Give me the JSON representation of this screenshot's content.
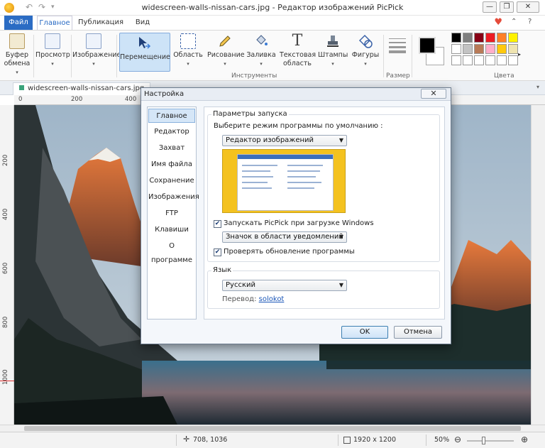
{
  "window": {
    "title": "widescreen-walls-nissan-cars.jpg - Редактор изображений PicPick",
    "min_glyph": "—",
    "restore_glyph": "❐",
    "close_glyph": "✕",
    "undo_glyph": "↶",
    "redo_glyph": "↷",
    "qa_menu_glyph": "▾"
  },
  "tabs": {
    "file": "Файл",
    "home": "Главное",
    "publish": "Публикация",
    "view": "Вид",
    "heart_glyph": "♥",
    "minimize_ribbon_glyph": "⌃",
    "help_glyph": "?"
  },
  "ribbon": {
    "clipboard": "Буфер\nобмена",
    "preview": "Просмотр",
    "image": "Изображение",
    "move": "Перемещение",
    "area": "Область",
    "draw": "Рисование",
    "fill": "Заливка",
    "text": "Текстовая\nобласть",
    "stamps": "Штампы",
    "shapes": "Фигуры",
    "group_tools": "Инструменты",
    "group_size": "Размер",
    "group_colors": "Цвета",
    "text_glyph": "T",
    "dropdown_glyph": "▾",
    "palette": [
      "#000000",
      "#7f7f7f",
      "#880015",
      "#ed1c24",
      "#ff7f27",
      "#fff200",
      "#ffffff",
      "#c3c3c3",
      "#b97a57",
      "#ffaec9",
      "#ffc90e",
      "#efe4b0",
      "#ffffff",
      "#ffffff",
      "#ffffff",
      "#ffffff",
      "#ffffff",
      "#ffffff"
    ]
  },
  "document": {
    "tab_name": "widescreen-walls-nissan-cars.jpg",
    "tab_close_glyph": "▾"
  },
  "ruler": {
    "top_ticks": [
      "0",
      "200",
      "400"
    ],
    "left_ticks": [
      "200",
      "400",
      "600",
      "800",
      "1000"
    ]
  },
  "dialog": {
    "title": "Настройка",
    "close_glyph": "✕",
    "nav": [
      "Главное",
      "Редактор",
      "Захват",
      "Имя файла",
      "Сохранение",
      "Изображения",
      "FTP",
      "Клавиши",
      "О программе"
    ],
    "startup_group": "Параметры запуска",
    "startup_prompt": "Выберите режим программы по умолчанию :",
    "startup_mode": "Редактор изображений",
    "launch_on_windows": "Запускать PicPick при загрузке Windows",
    "launch_on_windows_checked": "✔",
    "tray_mode": "Значок в области уведомлений",
    "check_updates": "Проверять обновление программы",
    "check_updates_checked": "✔",
    "language_group": "Язык",
    "language": "Русский",
    "translation_label": "Перевод:",
    "translator": "solokot",
    "ok": "OK",
    "cancel": "Отмена",
    "select_arrow": "▼"
  },
  "status": {
    "cursor": "708, 1036",
    "image_size": "1920 x 1200",
    "zoom": "50%",
    "zoom_out_glyph": "⊖",
    "zoom_in_glyph": "⊕",
    "zoom_level_fraction": 0.35
  }
}
